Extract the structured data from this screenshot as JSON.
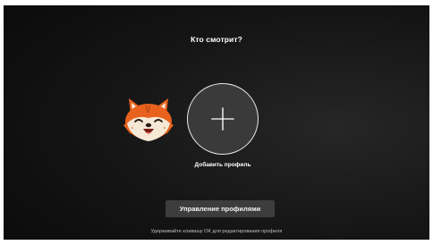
{
  "screen": {
    "title": "Кто смотрит?",
    "background_color": "#0a0a0a"
  },
  "profiles": [
    {
      "avatar": "fox-avatar-icon",
      "name": ""
    }
  ],
  "add_profile": {
    "icon": "plus-icon",
    "label": "Добавить профиль"
  },
  "manage_button": {
    "label": "Управление профилями",
    "color": "#3d3d3d"
  },
  "hint": {
    "text": "Удерживайте клавишу ОК для редактирования профиля"
  },
  "colors": {
    "fox_orange": "#e8621e",
    "fox_cream": "#f5e9d6",
    "circle_border": "#e8e8e8"
  }
}
